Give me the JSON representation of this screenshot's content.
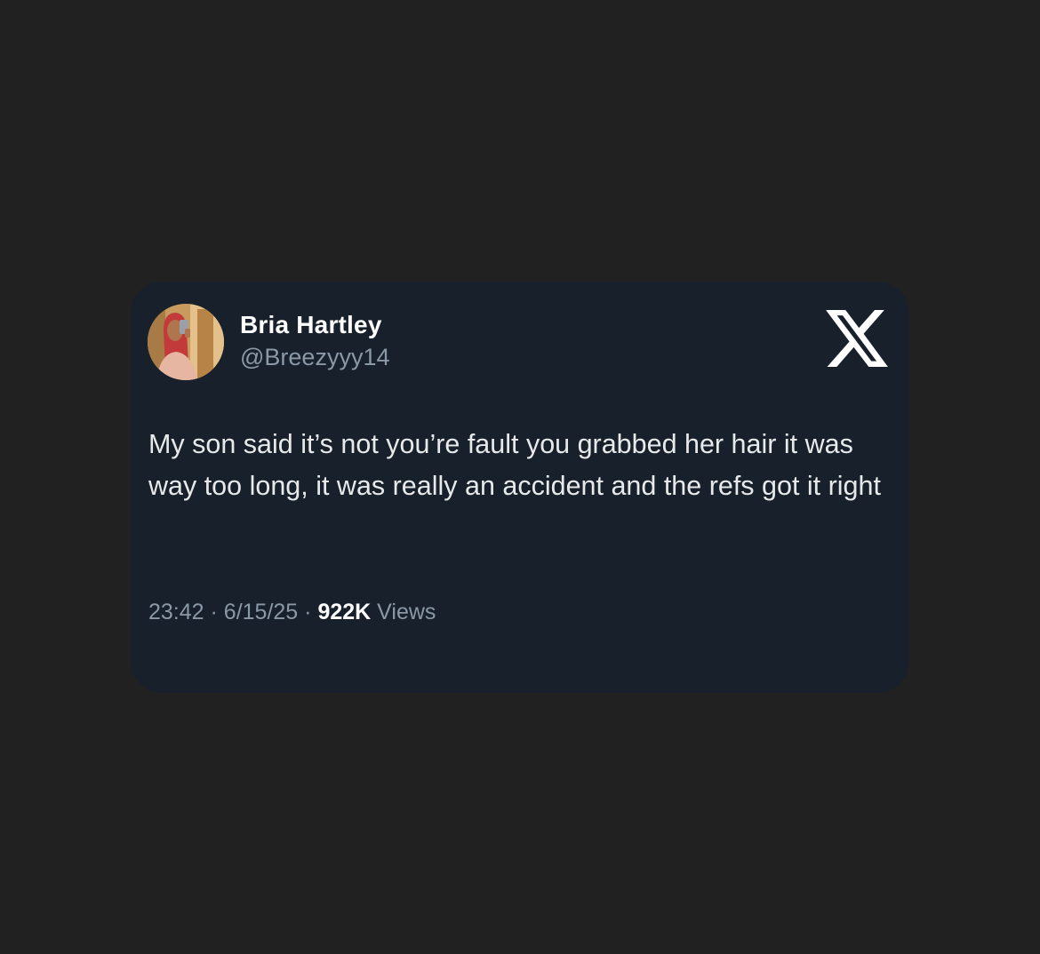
{
  "post": {
    "author_name": "Bria Hartley",
    "author_handle": "@Breezyyy14",
    "text": "My son said it’s not you’re fault you grabbed her hair it was way too long, it was really an accident and the refs got it right",
    "time": "23:42",
    "date": "6/15/25",
    "separator": "·",
    "views_count": "922K",
    "views_label": "Views"
  },
  "icons": {
    "brand": "x-logo-icon",
    "avatar": "profile-photo"
  },
  "colors": {
    "background": "#212121",
    "card": "#17202b",
    "primary_text": "#e7e9ea",
    "secondary_text": "#8b98a5"
  }
}
